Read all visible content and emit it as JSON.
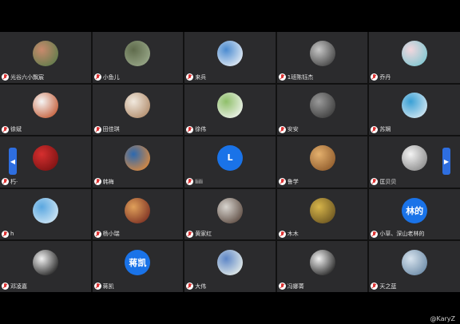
{
  "tiles": [
    {
      "name": "光谷六小飘宸",
      "avatar": "photo",
      "c1": "#c98a6d",
      "c2": "#5e7c4b"
    },
    {
      "name": "小鱼儿",
      "avatar": "photo",
      "c1": "#5f6b4c",
      "c2": "#9aa98a"
    },
    {
      "name": "来兵",
      "avatar": "photo",
      "c1": "#4b8bd0",
      "c2": "#e8eef5"
    },
    {
      "name": "1班陈钰杰",
      "avatar": "photo",
      "c1": "#c7c7c7",
      "c2": "#404040"
    },
    {
      "name": "乔丹",
      "avatar": "photo",
      "c1": "#f2d7de",
      "c2": "#7ec7d1"
    },
    {
      "name": "徐斌",
      "avatar": "photo",
      "c1": "#f5f5f5",
      "c2": "#c35b35"
    },
    {
      "name": "田佳琪",
      "avatar": "photo",
      "c1": "#f1e9de",
      "c2": "#b08b6a"
    },
    {
      "name": "徐伟",
      "avatar": "photo",
      "c1": "#8fbf6a",
      "c2": "#f0f4ee"
    },
    {
      "name": "安安",
      "avatar": "photo",
      "c1": "#9a9a9a",
      "c2": "#3b3b3b"
    },
    {
      "name": "苏娴",
      "avatar": "photo",
      "c1": "#3aa0d5",
      "c2": "#d7e9f2"
    },
    {
      "name": "朽·",
      "avatar": "photo",
      "c1": "#d62f2f",
      "c2": "#7a1212"
    },
    {
      "name": "韩梅",
      "avatar": "photo",
      "c1": "#2c69b0",
      "c2": "#e08a3a"
    },
    {
      "name": "liili",
      "avatar": "letter",
      "text": "L",
      "color": "#1a73e8"
    },
    {
      "name": "鲁学",
      "avatar": "photo",
      "c1": "#e4b06d",
      "c2": "#8e5a2b"
    },
    {
      "name": "匡贝贝",
      "avatar": "photo",
      "c1": "#f3f3f3",
      "c2": "#8a8a8a"
    },
    {
      "name": "h",
      "avatar": "photo",
      "c1": "#5aa7e0",
      "c2": "#d3e8f5"
    },
    {
      "name": "杨小瑞",
      "avatar": "photo",
      "c1": "#e0a05a",
      "c2": "#7b2f22"
    },
    {
      "name": "黄家红",
      "avatar": "photo",
      "c1": "#d7d4cf",
      "c2": "#5c4a40"
    },
    {
      "name": "木木",
      "avatar": "photo",
      "c1": "#d7b54a",
      "c2": "#6a5420"
    },
    {
      "name": "小草、深山老林的",
      "avatar": "letter",
      "text": "林的",
      "color": "#1a73e8"
    },
    {
      "name": "邓凌嘉",
      "avatar": "photo",
      "c1": "#f1f1f1",
      "c2": "#1f1f1f"
    },
    {
      "name": "蒋凯",
      "avatar": "letter",
      "text": "蒋凯",
      "color": "#1a73e8"
    },
    {
      "name": "大伟",
      "avatar": "photo",
      "c1": "#5d86c7",
      "c2": "#e9efe9"
    },
    {
      "name": "冯娜菁",
      "avatar": "photo",
      "c1": "#f0f0f0",
      "c2": "#202020"
    },
    {
      "name": "天之蓝",
      "avatar": "photo",
      "c1": "#d7e3ee",
      "c2": "#6b8aa6"
    }
  ],
  "watermark": "@KaryZ",
  "nav": {
    "left": "◀",
    "right": "▶"
  }
}
